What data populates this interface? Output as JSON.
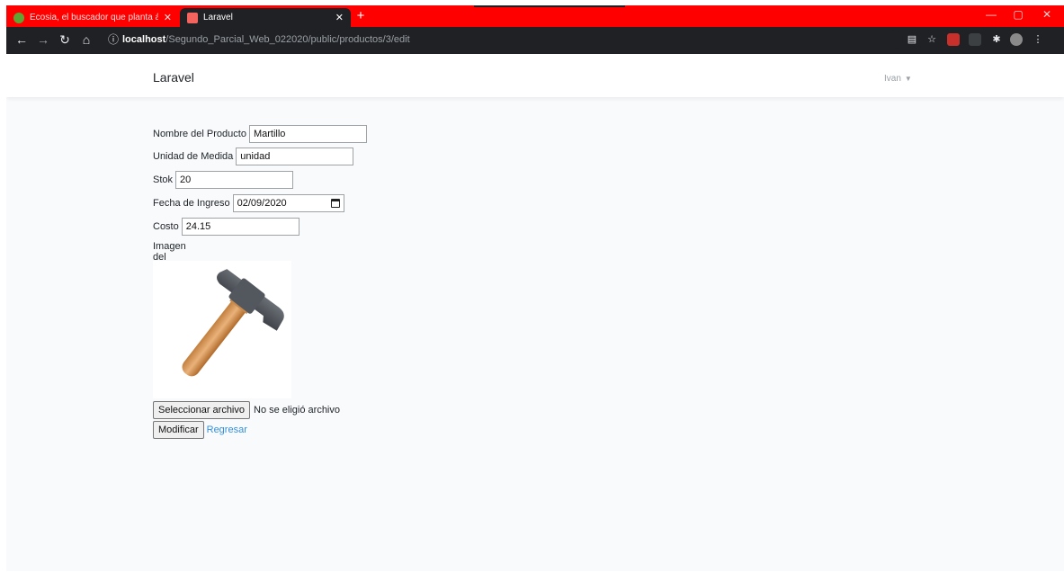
{
  "browser": {
    "tabs": [
      {
        "title": "Ecosia, el buscador que planta á",
        "active": false,
        "favicon_color": "#5fa533"
      },
      {
        "title": "Laravel",
        "active": true,
        "favicon_color": "#f4645f"
      }
    ],
    "new_tab": "+",
    "url": {
      "host": "localhost",
      "path": "/Segundo_Parcial_Web_022020/public/productos/3/edit"
    }
  },
  "navbar": {
    "brand": "Laravel",
    "user": "Ivan"
  },
  "form": {
    "fields": {
      "nombre": {
        "label": "Nombre del Producto",
        "value": "Martillo"
      },
      "unidad": {
        "label": "Unidad de Medida",
        "value": "unidad"
      },
      "stok": {
        "label": "Stok",
        "value": "20"
      },
      "fecha": {
        "label": "Fecha de Ingreso",
        "value": "02/09/2020"
      },
      "costo": {
        "label": "Costo",
        "value": "24.15"
      }
    },
    "image_label": "Imagen del Producto",
    "file_button": "Seleccionar archivo",
    "file_status": "No se eligió archivo",
    "submit_label": "Modificar",
    "back_link": "Regresar"
  },
  "colors": {
    "tab_strip": "#ff0000",
    "toolbar": "#202124",
    "page_bg": "#f8fafc",
    "link": "#3490dc"
  }
}
